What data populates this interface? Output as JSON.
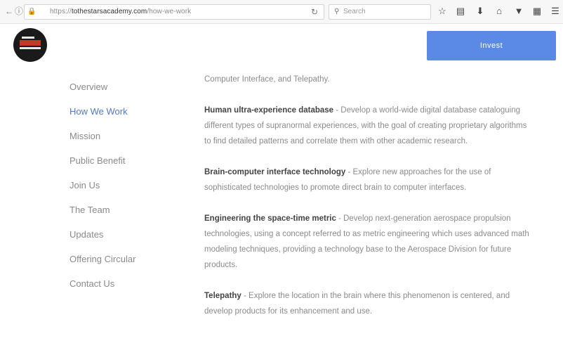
{
  "browser": {
    "url_prefix": "https://",
    "url_host": "tothestarsacademy.com",
    "url_path": "/how-we-work",
    "search_placeholder": "Search"
  },
  "header": {
    "cta_label": "Invest"
  },
  "sidebar": {
    "items": [
      {
        "label": "Overview"
      },
      {
        "label": "How We Work"
      },
      {
        "label": "Mission"
      },
      {
        "label": "Public Benefit"
      },
      {
        "label": "Join Us"
      },
      {
        "label": "The Team"
      },
      {
        "label": "Updates"
      },
      {
        "label": "Offering Circular"
      },
      {
        "label": "Contact Us"
      }
    ],
    "active_item": "How We Work"
  },
  "content": {
    "intro": "Computer Interface, and Telepathy.",
    "sections": [
      {
        "title": "Human ultra-experience database",
        "body": " - Develop a world-wide digital database cataloguing different types of supranormal experiences, with the goal of creating proprietary algorithms to find detailed patterns and correlate them with other academic research."
      },
      {
        "title": "Brain-computer interface technology",
        "body": " - Explore new approaches for the use of sophisticated technologies to promote direct brain to computer interfaces."
      },
      {
        "title": "Engineering the space-time metric",
        "body": " - Develop next-generation aerospace propulsion technologies, using a concept referred to as metric engineering which uses advanced math modeling techniques, providing a technology base to the Aerospace Division for future products."
      },
      {
        "title": "Telepathy",
        "body": " - Explore the location in the brain where this phenomenon is centered, and develop products for its enhancement and use."
      }
    ]
  },
  "colors": {
    "cta": "#5b8ae6",
    "active_link": "#4f79c9",
    "text": "#8b8b8b",
    "heading": "#444444"
  }
}
